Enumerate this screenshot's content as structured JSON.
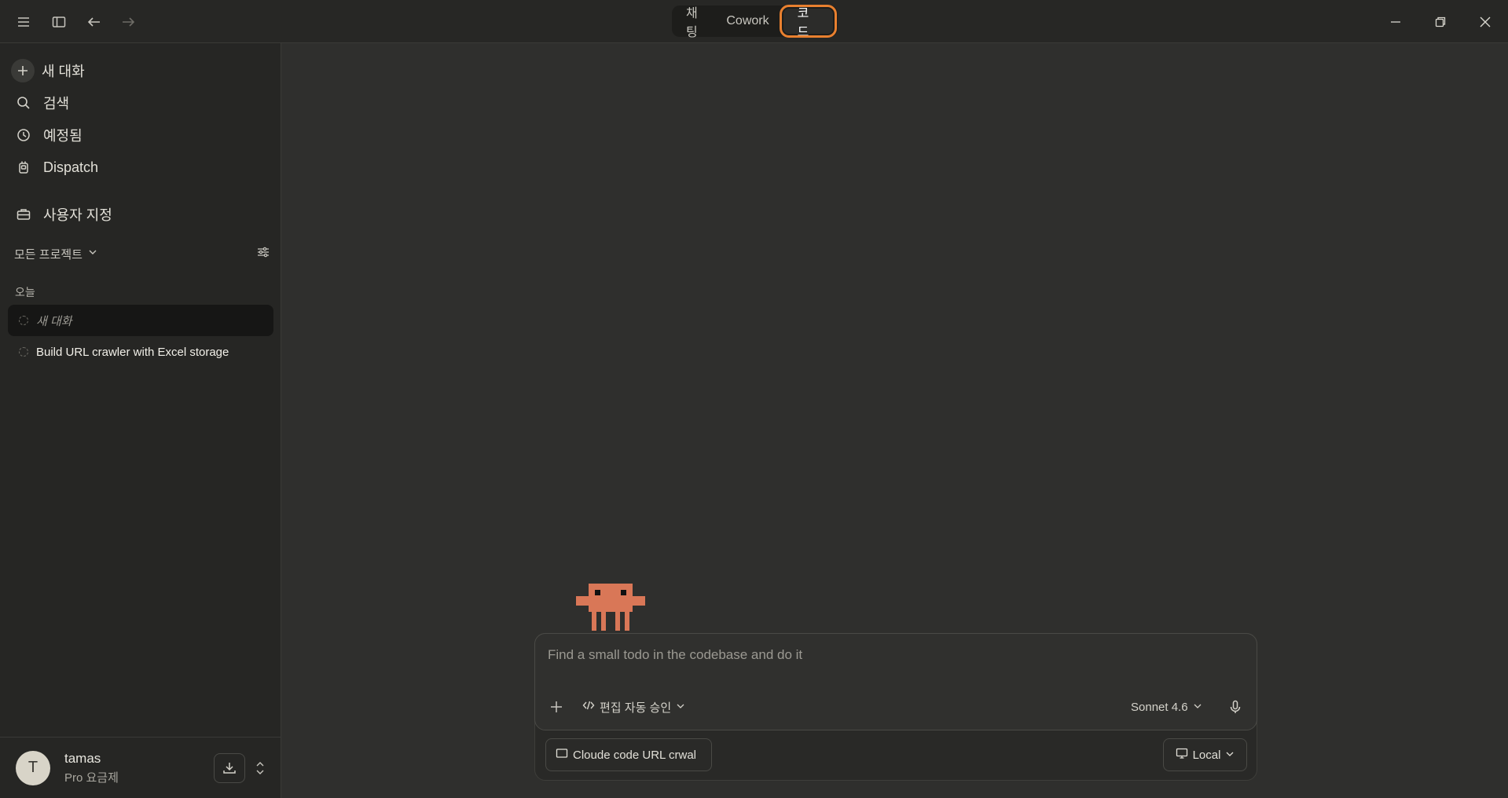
{
  "titlebar": {
    "tabs": [
      "채팅",
      "Cowork",
      "코드"
    ],
    "active_tab": "코드"
  },
  "sidebar": {
    "nav": [
      {
        "label": "새 대화",
        "icon": "plus-icon"
      },
      {
        "label": "검색",
        "icon": "search-icon"
      },
      {
        "label": "예정됨",
        "icon": "clock-icon"
      },
      {
        "label": "Dispatch",
        "icon": "dispatch-icon"
      }
    ],
    "customize": {
      "label": "사용자 지정",
      "icon": "briefcase-icon"
    },
    "projects_filter": "모든 프로젝트",
    "group_today": "오늘",
    "conversations": [
      {
        "title": "새 대화",
        "active": true
      },
      {
        "title": "Build URL crawler with Excel storage",
        "active": false
      }
    ],
    "user": {
      "initial": "T",
      "name": "tamas",
      "plan": "Pro 요금제"
    }
  },
  "composer": {
    "placeholder": "Find a small todo in the codebase and do it",
    "mode": "편집 자동 승인",
    "model": "Sonnet 4.6",
    "project": "Cloude code URL crwal",
    "environment": "Local"
  },
  "colors": {
    "accent_outline": "#e9802f",
    "mascot": "#d97757",
    "background": "#2f2f2d",
    "sidebar": "#262624"
  }
}
